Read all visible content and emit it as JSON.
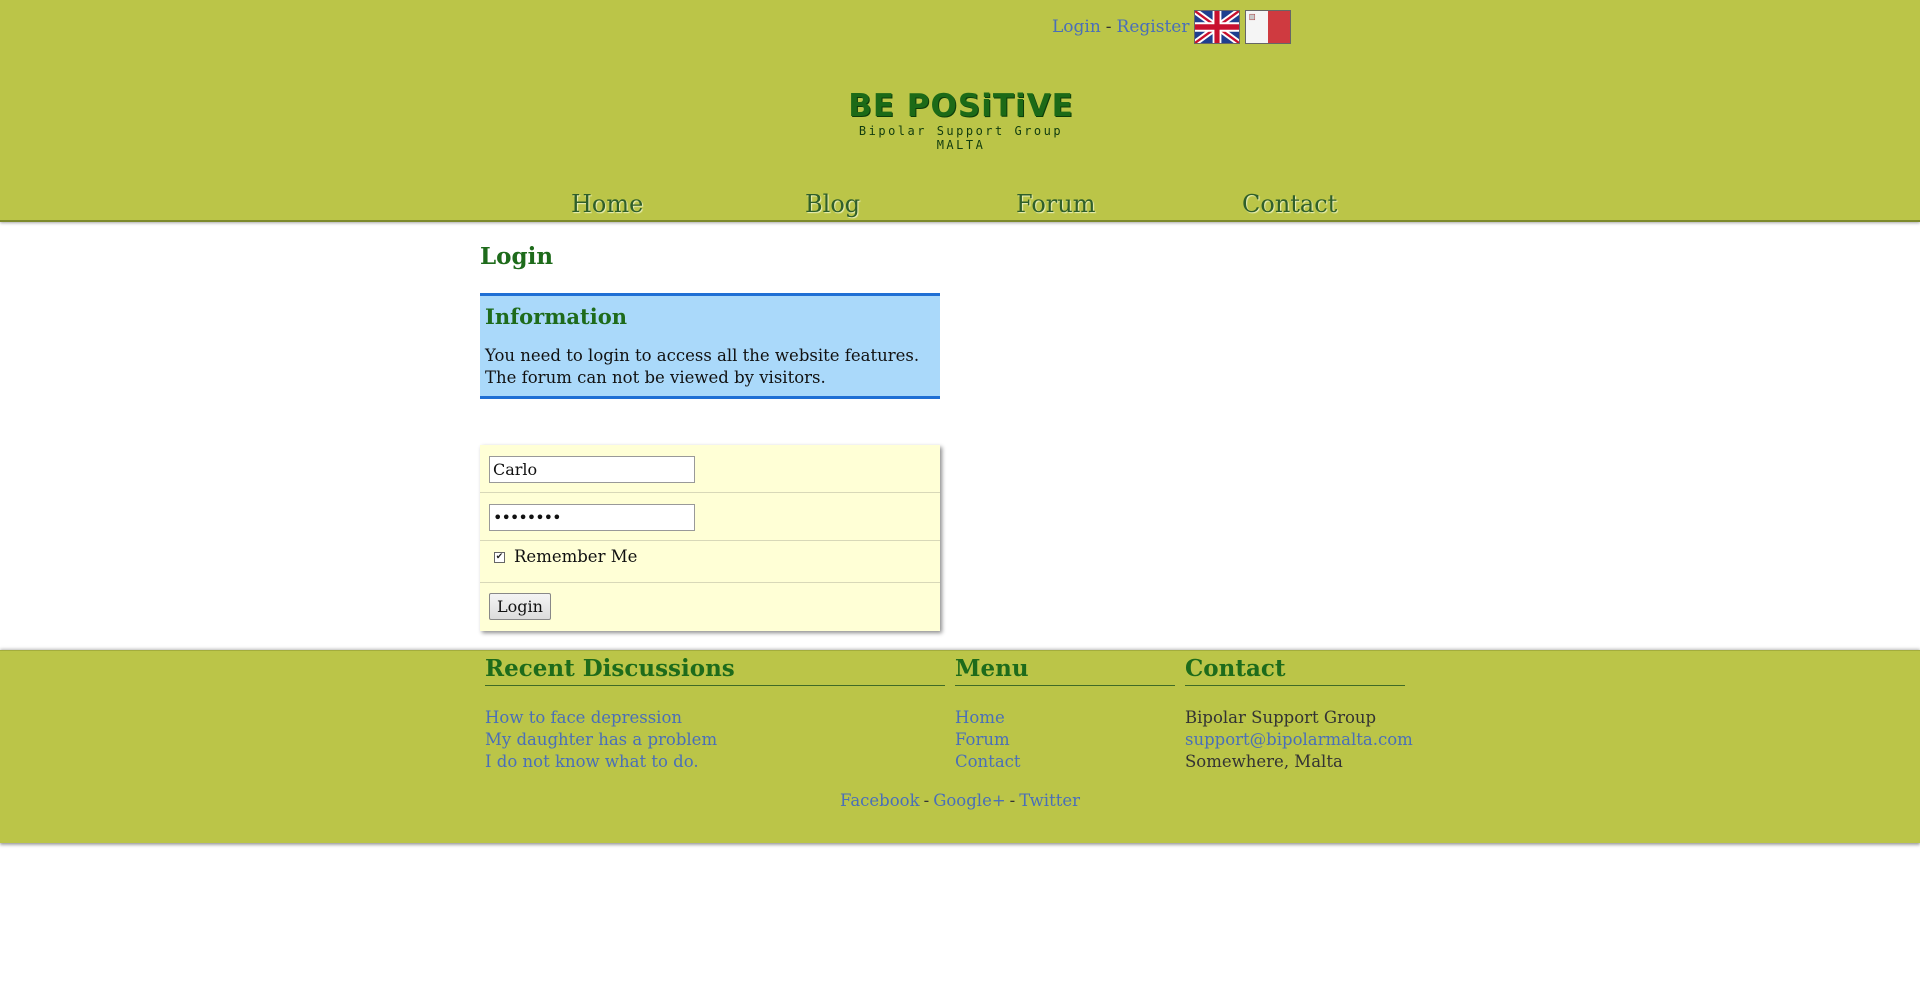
{
  "top_links": {
    "login": "Login",
    "separator": "-",
    "register": "Register"
  },
  "flags": [
    {
      "name": "uk-flag-icon"
    },
    {
      "name": "malta-flag-icon"
    }
  ],
  "logo": {
    "title": "BE POSiTiVE",
    "subtitle": "Bipolar Support Group MALTA"
  },
  "nav": {
    "items": [
      "Home",
      "Blog",
      "Forum",
      "Contact"
    ]
  },
  "page_title": "Login",
  "info": {
    "title": "Information",
    "text": "You need to login to access all the website features. The forum can not be viewed by visitors."
  },
  "form": {
    "username_value": "Carlo",
    "password_value": "••••••••",
    "remember_checked": true,
    "remember_label": "Remember Me",
    "submit_label": "Login"
  },
  "footer": {
    "recent": {
      "title": "Recent Discussions",
      "items": [
        "How to face depression",
        "My daughter has a problem",
        "I do not know what to do."
      ]
    },
    "menu": {
      "title": "Menu",
      "items": [
        "Home",
        "Forum",
        "Contact"
      ]
    },
    "contact": {
      "title": "Contact",
      "lines": [
        "Bipolar Support Group",
        "support@bipolarmalta.com",
        "Somewhere, Malta"
      ]
    },
    "social": [
      "Facebook",
      "Google+",
      "Twitter"
    ],
    "social_separator": "-"
  },
  "colors": {
    "header_bg": "#bbc548",
    "heading_green": "#1e6b1b",
    "link_blue": "#4a6fb8",
    "info_bg": "#aad9fa",
    "info_border": "#1f6fd4",
    "form_bg": "#ffffd6"
  }
}
